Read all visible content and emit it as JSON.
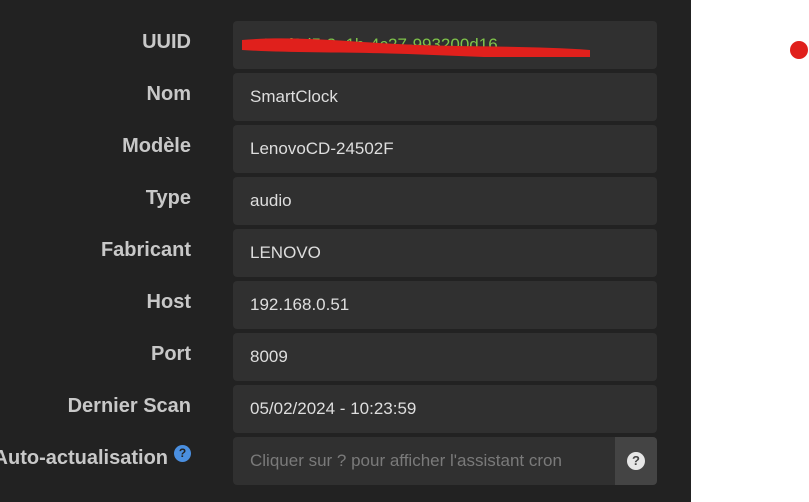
{
  "fields": {
    "uuid": {
      "label": "UUID",
      "value": "e4e9f0d5-3a1b-4c27-993200d16"
    },
    "nom": {
      "label": "Nom",
      "value": "SmartClock"
    },
    "modele": {
      "label": "Modèle",
      "value": "LenovoCD-24502F"
    },
    "type": {
      "label": "Type",
      "value": "audio"
    },
    "fabricant": {
      "label": "Fabricant",
      "value": "LENOVO"
    },
    "host": {
      "label": "Host",
      "value": "192.168.0.51"
    },
    "port": {
      "label": "Port",
      "value": "8009"
    },
    "dernier_scan": {
      "label": "Dernier Scan",
      "value": "05/02/2024 - 10:23:59"
    },
    "auto": {
      "label": "Auto-actualisation",
      "value": "",
      "placeholder": "Cliquer sur ? pour afficher l'assistant cron",
      "help_glyph": "?",
      "addon_glyph": "?"
    }
  },
  "icons": {
    "help": "question-circle-icon",
    "addon": "question-circle-icon"
  },
  "colors": {
    "panel_bg": "#222222",
    "field_bg": "#303030",
    "label_text": "#c8c8c8",
    "field_text": "#dedede",
    "help_icon": "#4a8fe0",
    "redaction": "#e0201c",
    "uuid_text": "#7ec34a"
  }
}
